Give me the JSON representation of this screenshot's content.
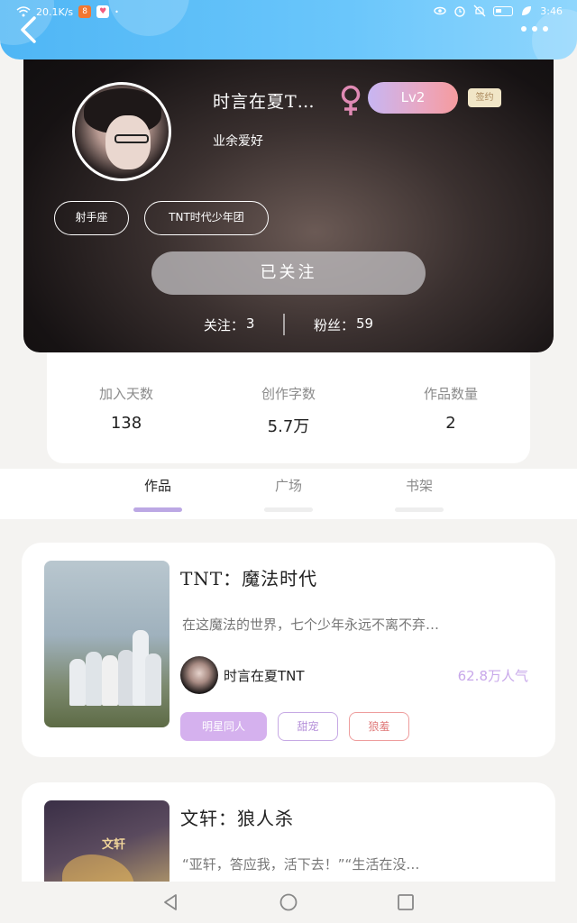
{
  "status_bar": {
    "speed": "20.1K/s",
    "time": "3:46"
  },
  "profile": {
    "username": "时言在夏T…",
    "level": "Lv2",
    "signed_badge": "签约",
    "bio": "业余爱好",
    "tags": [
      "射手座",
      "TNT时代少年团"
    ],
    "follow_button": "已关注",
    "following_label": "关注：",
    "following_count": "3",
    "fans_label": "粉丝：",
    "fans_count": "59"
  },
  "stats": [
    {
      "label": "加入天数",
      "value": "138"
    },
    {
      "label": "创作字数",
      "value": "5.7万"
    },
    {
      "label": "作品数量",
      "value": "2"
    }
  ],
  "tabs": [
    {
      "label": "作品",
      "active": true
    },
    {
      "label": "广场",
      "active": false
    },
    {
      "label": "书架",
      "active": false
    }
  ],
  "works": [
    {
      "title": "TNT：魔法时代",
      "desc": "在这魔法的世界，七个少年永远不离不弃…",
      "author": "时言在夏TNT",
      "popularity": "62.8万人气",
      "tags": [
        "明星同人",
        "甜宠",
        "狼羞"
      ]
    },
    {
      "title": "文轩：狼人杀",
      "desc": "“亚轩，答应我，活下去！”“生活在没…",
      "cover_text": "文轩"
    }
  ],
  "colors": {
    "header_blue": "#4fb6f5",
    "level_gradient_start": "#c7b6f3",
    "level_gradient_end": "#f59b9e",
    "tab_active": "#bca8e4",
    "popularity": "#c8a8ea",
    "gender": "#e08ab4"
  },
  "icons": {
    "back": "chevron-left-icon",
    "more": "more-dots-icon",
    "gender": "female-icon",
    "nav_back": "triangle-back-icon",
    "nav_home": "circle-home-icon",
    "nav_recent": "square-recent-icon"
  }
}
